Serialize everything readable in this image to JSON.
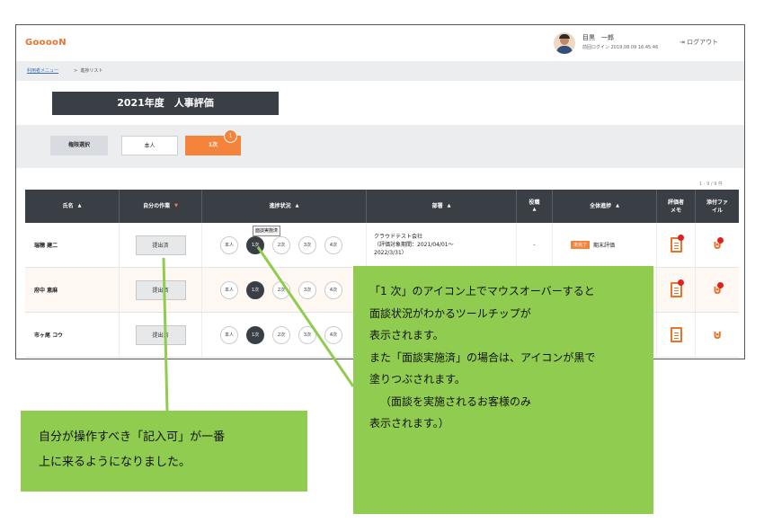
{
  "header": {
    "logo": "GooooN",
    "user_name": "目黒　一郎",
    "last_login": "前回ログイン 2019.08.09 16:45:46",
    "logout_label": "ログアウト"
  },
  "breadcrumb": {
    "root": "利用者メニュー",
    "separator": ">",
    "current": "進捗リスト"
  },
  "page_title": "2021年度　人事評価",
  "filter": {
    "select_label": "権限選択",
    "options": [
      "本人",
      "1次"
    ],
    "active": "1次",
    "active_badge": "1"
  },
  "count": "1 - 9 / 9 件",
  "table": {
    "headers": [
      "氏名",
      "自分の作業",
      "進捗状況",
      "部署",
      "役職",
      "全体進捗",
      "評価者メモ",
      "添付ファイル"
    ],
    "header_lines": {
      "role": [
        "役職",
        "▲"
      ],
      "memo": [
        "評価者",
        "メモ"
      ],
      "file": [
        "添付ファ",
        "イル"
      ]
    },
    "sort_arrow": "▲",
    "task_arrow": "▼",
    "stage_labels": [
      "本人",
      "1次",
      "2次",
      "3次",
      "4次"
    ],
    "rows": [
      {
        "name": "瑞穂 建二",
        "task": "提出済",
        "dept_line1": "クラウドテスト会社",
        "dept_line2": "（評価対象期間：2021/04/01～",
        "dept_line3": "2022/3/31）",
        "role": "-",
        "status_tag": "未完了",
        "status_text": "期末評価",
        "tooltip": "面談実施済"
      },
      {
        "name": "府中 恵麻",
        "task": "提出済"
      },
      {
        "name": "市ヶ尾 コウ",
        "task": "提出済"
      }
    ]
  },
  "callouts": {
    "right": [
      "「1 次」のアイコン上でマウスオーバーすると",
      "面談状況がわかるツールチップが",
      "表示されます。",
      "また「面談実施済」の場合は、アイコンが黒で",
      "塗りつぶされます。",
      "（面談を実施されるお客様のみ",
      "表示されます。）"
    ],
    "left": [
      "自分が操作すべき「記入可」が一番",
      "上に来るようになりました。"
    ]
  },
  "colors": {
    "accent": "#f4833b",
    "header_dark": "#3a3f46",
    "callout": "#8fcc4f"
  }
}
